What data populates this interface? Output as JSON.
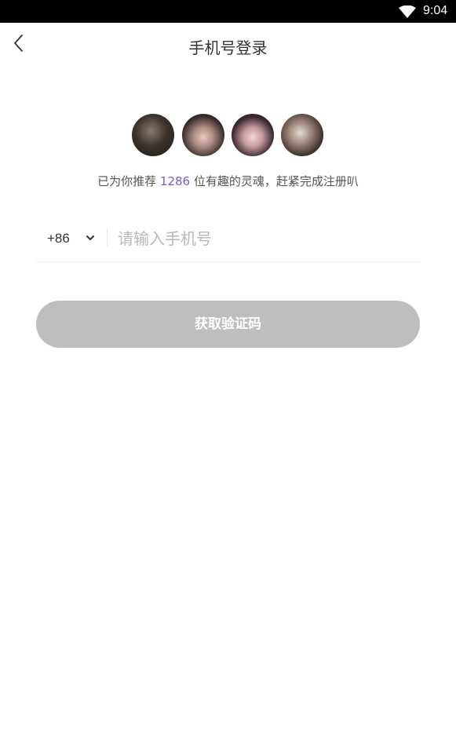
{
  "status_bar": {
    "time": "9:04",
    "icons": [
      "wifi-icon"
    ]
  },
  "header": {
    "title": "手机号登录",
    "back_icon": "chevron-left-icon"
  },
  "avatars": {
    "count": 4
  },
  "subtitle": {
    "prefix": "已为你推荐",
    "count": "1286",
    "suffix": "位有趣的灵魂，赶紧完成注册叭",
    "count_color": "#7b5cc7"
  },
  "phone": {
    "country_code": "+86",
    "dropdown_icon": "chevron-down-icon",
    "value": "",
    "placeholder": "请输入手机号"
  },
  "actions": {
    "get_code_label": "获取验证码",
    "button_color": "#bebebe"
  }
}
